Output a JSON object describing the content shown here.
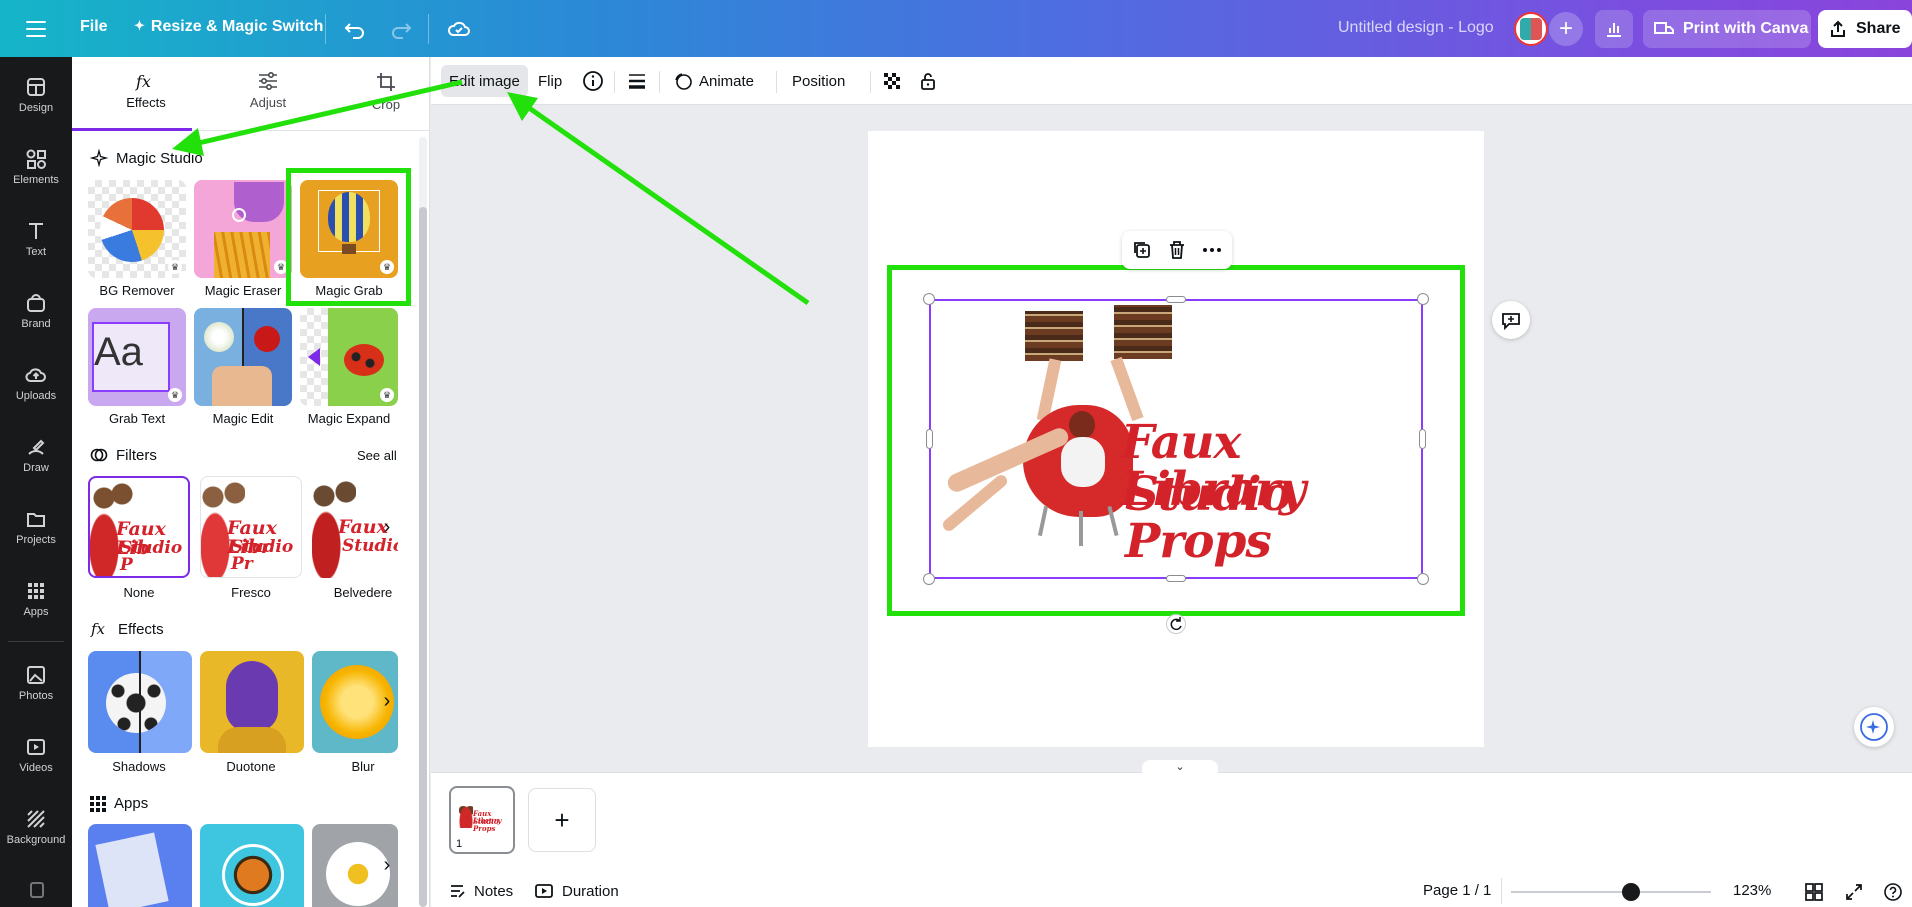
{
  "topbar": {
    "file_label": "File",
    "resize_label": "Resize & Magic Switch",
    "design_title": "Untitled design - Logo",
    "print_label": "Print with Canva",
    "share_label": "Share",
    "add_label": "+"
  },
  "rail": {
    "items": [
      {
        "label": "Design",
        "icon": "design-icon"
      },
      {
        "label": "Elements",
        "icon": "elements-icon"
      },
      {
        "label": "Text",
        "icon": "text-icon"
      },
      {
        "label": "Brand",
        "icon": "brand-icon"
      },
      {
        "label": "Uploads",
        "icon": "uploads-icon"
      },
      {
        "label": "Draw",
        "icon": "draw-icon"
      },
      {
        "label": "Projects",
        "icon": "projects-icon"
      },
      {
        "label": "Apps",
        "icon": "apps-icon"
      },
      {
        "label": "Photos",
        "icon": "photos-icon"
      },
      {
        "label": "Videos",
        "icon": "videos-icon"
      },
      {
        "label": "Background",
        "icon": "background-icon"
      }
    ]
  },
  "panel": {
    "tabs": [
      {
        "label": "Effects"
      },
      {
        "label": "Adjust"
      },
      {
        "label": "Crop"
      }
    ],
    "magic_studio": {
      "title": "Magic Studio",
      "items": [
        {
          "label": "BG Remover"
        },
        {
          "label": "Magic Eraser"
        },
        {
          "label": "Magic Grab"
        },
        {
          "label": "Grab Text"
        },
        {
          "label": "Magic Edit"
        },
        {
          "label": "Magic Expand"
        }
      ]
    },
    "filters": {
      "title": "Filters",
      "see_all": "See all",
      "items": [
        {
          "label": "None"
        },
        {
          "label": "Fresco"
        },
        {
          "label": "Belvedere"
        }
      ]
    },
    "effects": {
      "title": "Effects",
      "items": [
        {
          "label": "Shadows"
        },
        {
          "label": "Duotone"
        },
        {
          "label": "Blur"
        }
      ]
    },
    "apps": {
      "title": "Apps"
    },
    "mini_logo_line1": "Faux Lib",
    "mini_logo_line2": "Studio P",
    "mini_logo_line1b": "Faux Libr",
    "mini_logo_line2b": "Studio Pr",
    "mini_logo_line1c": "Faux",
    "mini_logo_line2c": "Studio",
    "grab_text_sample": "Aa"
  },
  "context_toolbar": {
    "edit_image": "Edit image",
    "flip": "Flip",
    "animate": "Animate",
    "position": "Position"
  },
  "canvas": {
    "logo_line1": "Faux Library",
    "logo_line2": "Studio Props"
  },
  "bottom": {
    "page_number": "1",
    "add_page": "+",
    "notes": "Notes",
    "duration": "Duration",
    "page_indicator": "Page 1 / 1",
    "zoom_level": "123%",
    "zoom_fraction": 0.6,
    "thumb_line1": "Faux Library",
    "thumb_line2": "Studio Props"
  },
  "colors": {
    "accent": "#7d2ae8",
    "selection": "#8b3dff",
    "highlight_green": "#22e00a",
    "logo_red": "#d3222a"
  }
}
